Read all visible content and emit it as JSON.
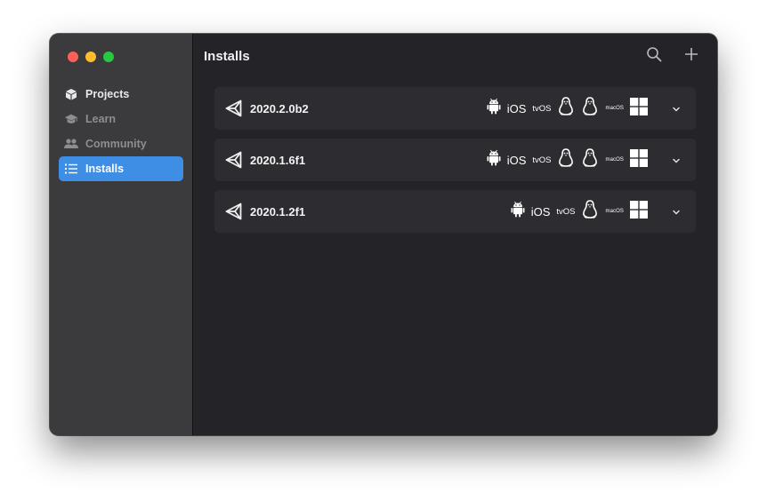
{
  "window": {
    "title": "Installs"
  },
  "sidebar": {
    "items": [
      {
        "label": "Projects",
        "icon": "cube-icon",
        "state": "normal"
      },
      {
        "label": "Learn",
        "icon": "graduation-cap-icon",
        "state": "dimmed"
      },
      {
        "label": "Community",
        "icon": "people-icon",
        "state": "dimmed"
      },
      {
        "label": "Installs",
        "icon": "list-icon",
        "state": "selected"
      }
    ]
  },
  "toolbar": {
    "search_icon": "search-icon",
    "add_icon": "plus-icon"
  },
  "installs": [
    {
      "version": "2020.2.0b2",
      "platforms": [
        "android",
        "iOS",
        "tvOS",
        "linux",
        "linux",
        "macOS",
        "windows"
      ]
    },
    {
      "version": "2020.1.6f1",
      "platforms": [
        "android",
        "iOS",
        "tvOS",
        "linux",
        "linux",
        "macOS",
        "windows"
      ]
    },
    {
      "version": "2020.1.2f1",
      "platforms": [
        "android",
        "iOS",
        "tvOS",
        "linux",
        "macOS",
        "windows"
      ]
    }
  ],
  "colors": {
    "accent": "#3e8ee6",
    "sidebar_bg": "#3b3b3e",
    "main_bg": "#242428",
    "row_bg": "#2d2d31"
  }
}
